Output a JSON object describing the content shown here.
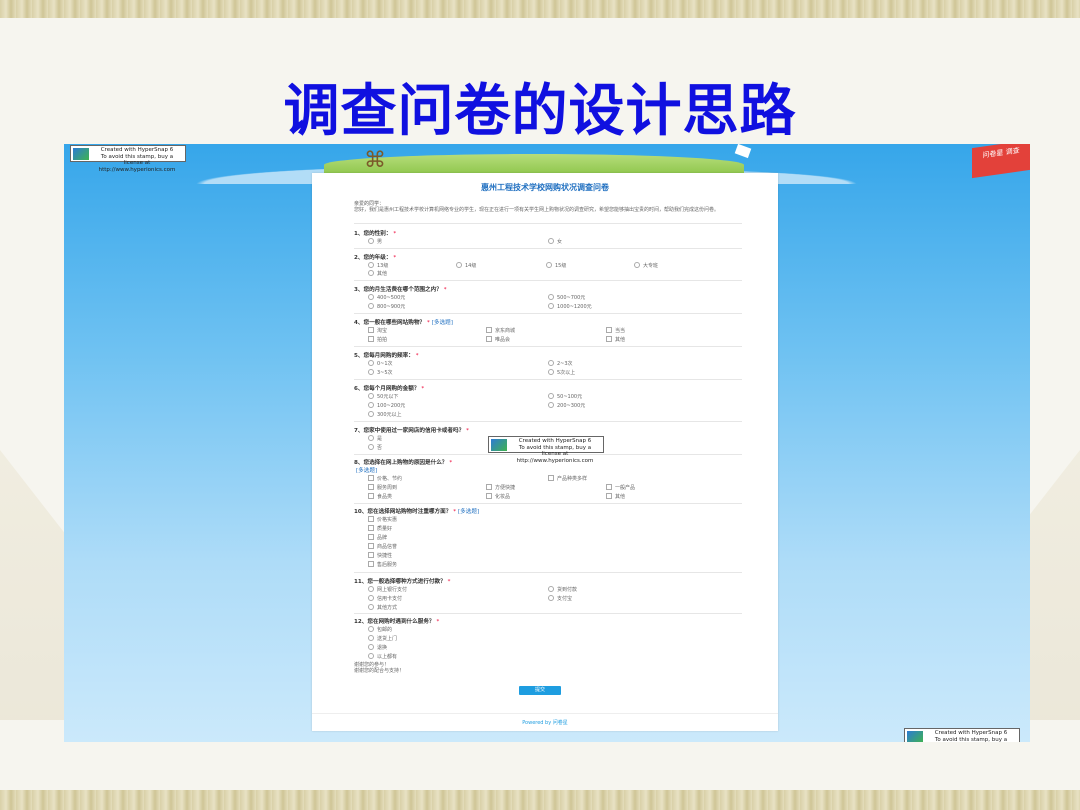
{
  "slide": {
    "title": "调查问卷的设计思路"
  },
  "watermark": {
    "line1": "Created with HyperSnap 6",
    "line2": "To avoid this stamp, buy a license at",
    "line3": "http://www.hyperionics.com"
  },
  "badge": {
    "text": "问卷星 调查"
  },
  "form": {
    "title": "惠州工程技术学校网购状况调查问卷",
    "intro_label": "亲爱的同学：",
    "intro_text": "您好，我们是惠州工程技术学校计算机网络专业的学生，现在正在进行一项有关学生网上购物状况的调查研究，希望您能够抽出宝贵的时间，帮助我们完成这份问卷。",
    "questions": [
      {
        "title": "1、您的性别：",
        "required": "*",
        "multi": "",
        "options": [
          "男",
          "女"
        ]
      },
      {
        "title": "2、您的年级：",
        "required": "*",
        "multi": "",
        "options": [
          "13级",
          "14级",
          "15级",
          "大专班",
          "其他"
        ]
      },
      {
        "title": "3、您的月生活费在哪个范围之内？",
        "required": "*",
        "multi": "",
        "options": [
          "400~500元",
          "500~700元",
          "800~900元",
          "1000~1200元"
        ]
      },
      {
        "title": "4、您一般在哪些网站购物？",
        "required": "*",
        "multi": "[多选题]",
        "options": [
          "淘宝",
          "京东商城",
          "当当",
          "拍拍",
          "唯品会",
          "其他"
        ]
      },
      {
        "title": "5、您每月网购的频率：",
        "required": "*",
        "multi": "",
        "options": [
          "0~1次",
          "2~3次",
          "3~5次",
          "5次以上"
        ]
      },
      {
        "title": "6、您每个月网购的金额？",
        "required": "*",
        "multi": "",
        "options": [
          "50元以下",
          "50~100元",
          "100~200元",
          "200~300元",
          "300元以上"
        ]
      },
      {
        "title": "7、您家中使用过一家网店的信用卡或者吗？",
        "required": "*",
        "multi": "",
        "options": [
          "是",
          "否"
        ]
      },
      {
        "title": "8、您选择在网上购物的原因是什么？",
        "required": "*",
        "multi": "[多选题]",
        "options": [
          "价格、节约",
          "产品种类多样",
          "服务周到",
          "方便快捷",
          "一般产品",
          "食品类",
          "化妆品",
          "其他"
        ]
      },
      {
        "title": "10、您在选择网站购物时注重哪方面？",
        "required": "*",
        "multi": "[多选题]",
        "options": [
          "价格实惠",
          "质量好",
          "品牌",
          "商品信誉",
          "快捷性",
          "售后服务"
        ]
      },
      {
        "title": "11、您一般选择哪种方式进行付款？",
        "required": "*",
        "multi": "",
        "options": [
          "网上银行支付",
          "货到付款",
          "信用卡支付",
          "支付宝",
          "其他方式"
        ]
      },
      {
        "title": "12、您在网购时遇到什么服务？",
        "required": "*",
        "multi": "",
        "options": [
          "包邮的",
          "送货上门",
          "退换",
          "以上都有"
        ]
      }
    ],
    "tail_line1": "谢谢您的参与！",
    "tail_line2": "谢谢您的配合与支持！",
    "submit_label": "提交",
    "powered_by": "Powered by 问卷星"
  }
}
